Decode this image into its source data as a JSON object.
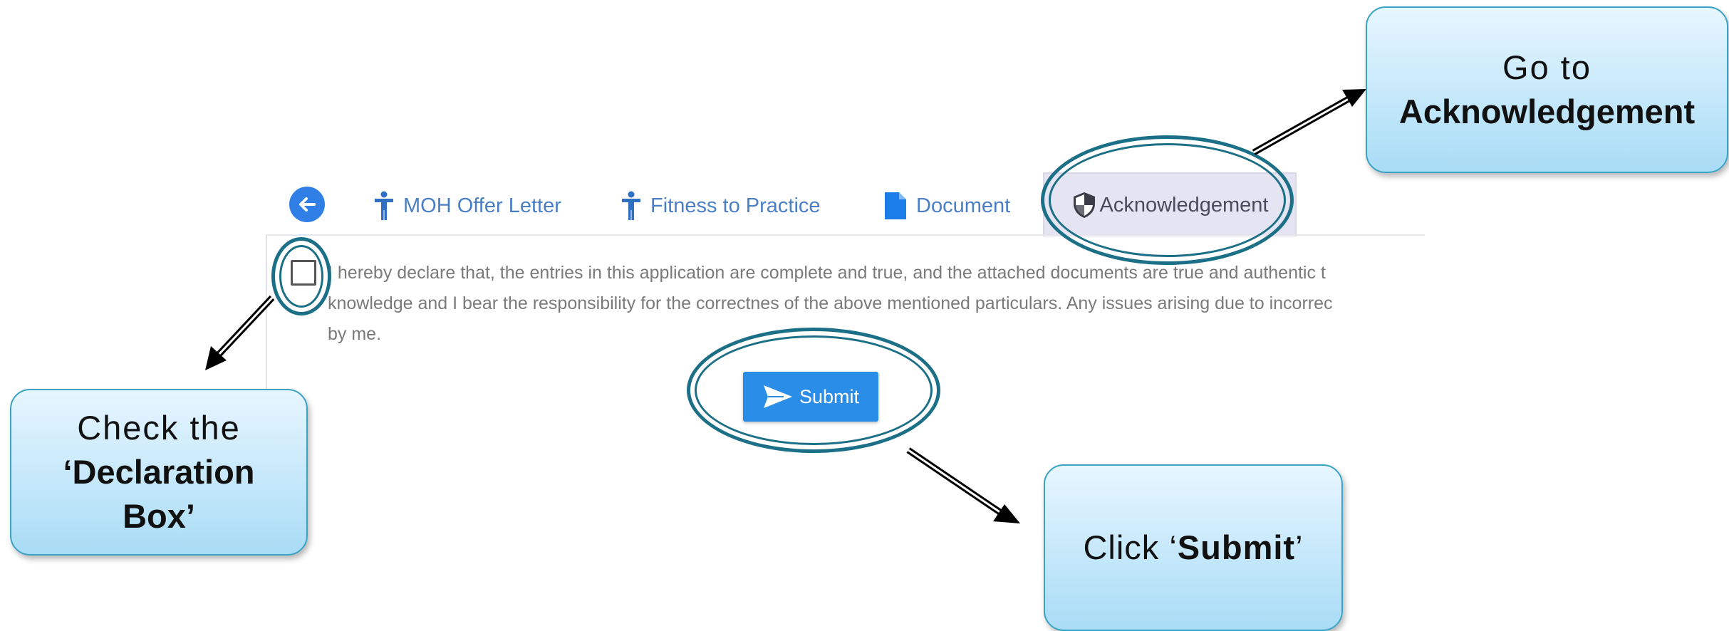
{
  "tabs": {
    "back_label": "",
    "items": [
      {
        "label": "MOH Offer Letter",
        "icon": "person-icon"
      },
      {
        "label": "Fitness to Practice",
        "icon": "person-icon"
      },
      {
        "label": "Document",
        "icon": "document-icon"
      },
      {
        "label": "Acknowledgement",
        "icon": "shield-icon",
        "active": true
      }
    ]
  },
  "declaration": {
    "lines": [
      "I hereby declare that, the entries in this application are complete and true, and the attached documents are true and authentic t",
      "knowledge and I bear the responsibility for the correctnes of the above mentioned particulars. Any issues arising due to incorrec",
      "by me."
    ]
  },
  "submit": {
    "label": "Submit"
  },
  "callouts": {
    "acknowledgement": {
      "line1": "Go to",
      "line2": "Acknowledgement"
    },
    "checkbox": {
      "line1": "Check the",
      "line2": "‘Declaration",
      "line3": "Box’"
    },
    "submit": {
      "prefix": "Click ‘",
      "bold": "Submit",
      "suffix": "’"
    }
  },
  "colors": {
    "accent": "#2a8de8",
    "tab_text": "#4a7fc6",
    "callout_ring": "#1b6f86",
    "callout_fill": "#a9dcf6"
  }
}
